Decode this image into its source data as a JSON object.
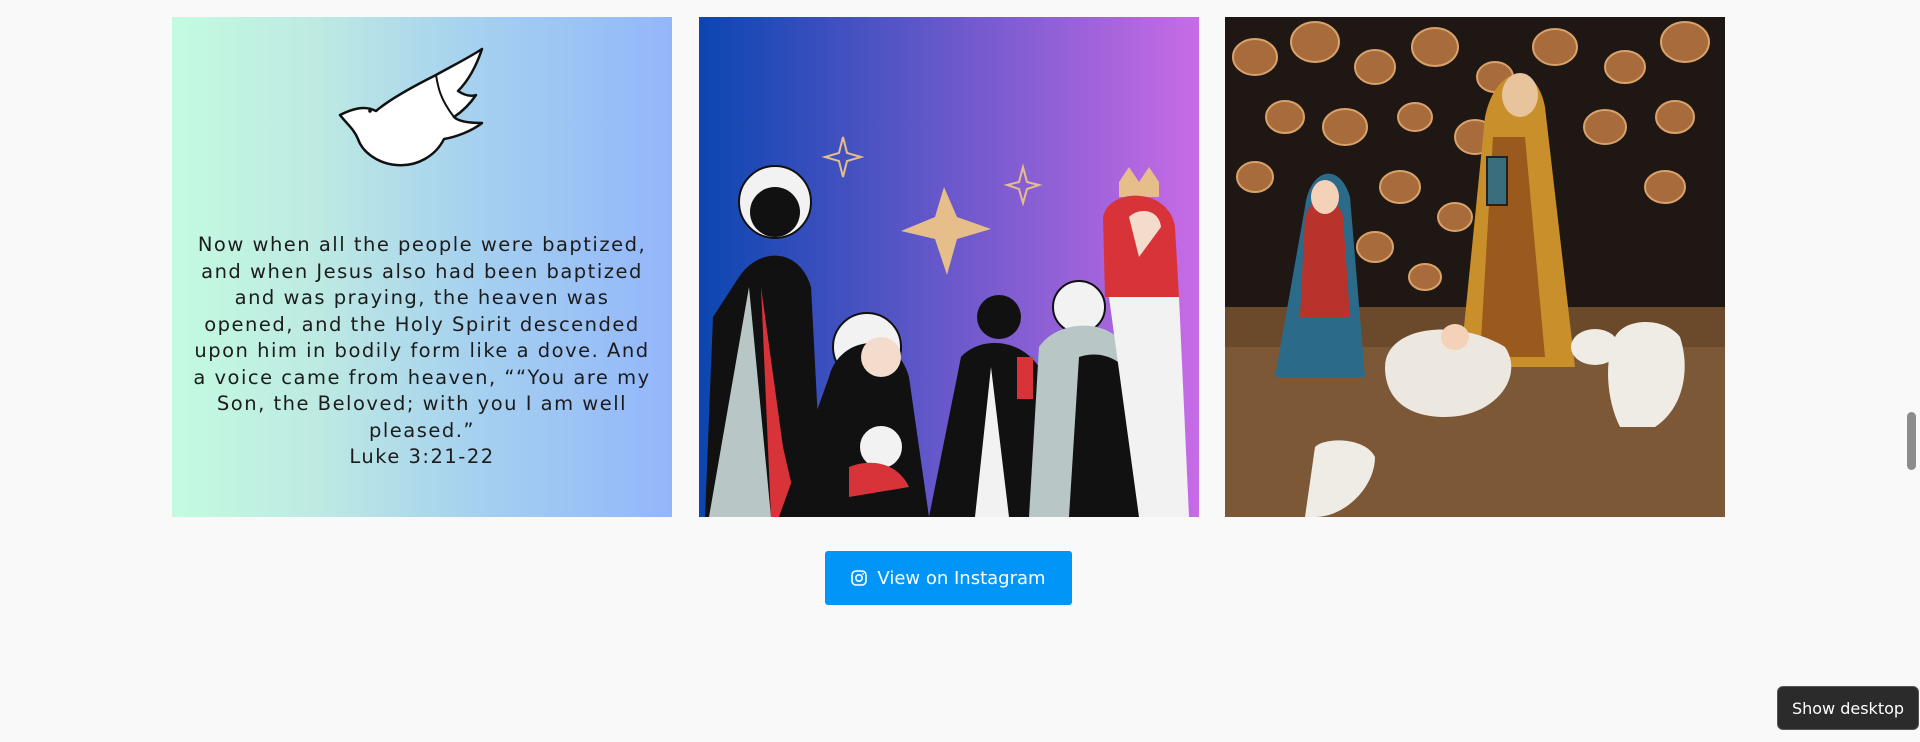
{
  "tiles": {
    "verse": {
      "text": "Now when all the people were baptized, and when Jesus also had been baptized and was praying, the heaven was opened, and the Holy Spirit descended upon him in bodily form like a dove. And a voice came from heaven, ““You are my Son, the Beloved; with you I am well pleased.”",
      "reference": "Luke 3:21-22",
      "gradient": [
        "#c4fbe0",
        "#93b6fb"
      ]
    },
    "nativity_illustration": {
      "gradient": [
        "#0b46b0",
        "#c86be6"
      ]
    },
    "nativity_photo": {}
  },
  "button": {
    "label": "View on Instagram",
    "color": "#0095f6",
    "icon": "instagram-icon"
  },
  "tooltip": {
    "label": "Show desktop"
  }
}
